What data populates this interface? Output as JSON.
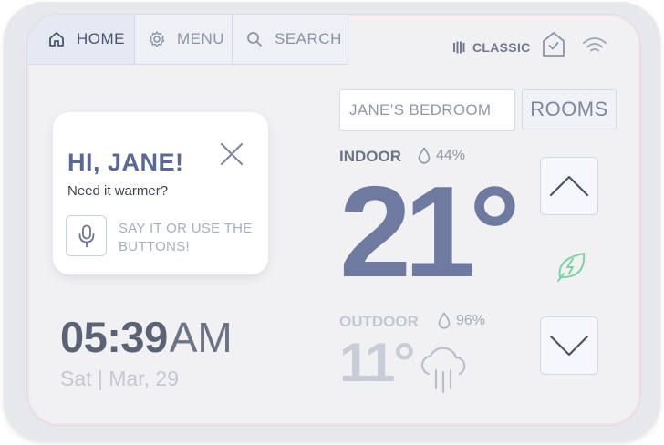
{
  "nav": {
    "home_label": "HOME",
    "menu_label": "MENU",
    "search_label": "SEARCH"
  },
  "status": {
    "mode_label": "CLASSIC"
  },
  "greeting": {
    "title": "HI, JANE!",
    "subtitle": "Need it warmer?",
    "voice_hint": "SAY IT OR USE THE BUTTONS!"
  },
  "clock": {
    "time": "05:39",
    "ampm": "AM",
    "date": "Sat | Mar, 29"
  },
  "room": {
    "current": "JANE’S BEDROOM",
    "rooms_label": "ROOMS"
  },
  "indoor": {
    "label": "INDOOR",
    "humidity": "44%",
    "temperature": "21°"
  },
  "outdoor": {
    "label": "OUTDOOR",
    "humidity": "96%",
    "temperature": "11°"
  },
  "icons": {
    "home": "home-icon",
    "menu": "gear-icon",
    "search": "search-icon",
    "mode": "classic-mode-icon",
    "house_check": "house-check-icon",
    "wifi": "wifi-icon",
    "close": "close-icon",
    "mic": "microphone-icon",
    "humidity": "droplet-icon",
    "weather": "rain-cloud-icon",
    "up": "chevron-up-icon",
    "down": "chevron-down-icon",
    "eco": "eco-leaf-icon"
  },
  "colors": {
    "accent": "#6e7a9f",
    "eco_green": "#7fd3a0",
    "text_dark": "#5b6274"
  }
}
